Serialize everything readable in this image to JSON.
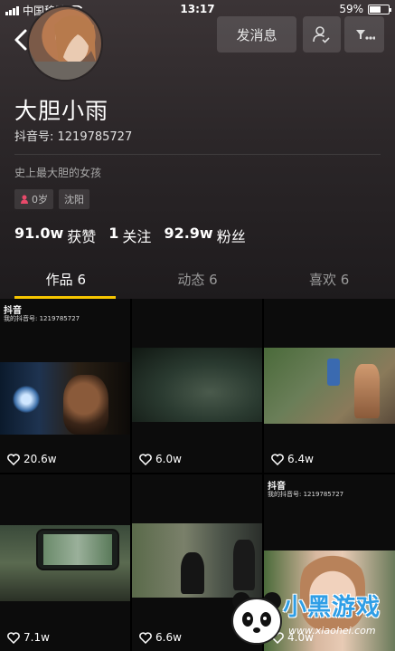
{
  "status_bar": {
    "carrier": "中国移动",
    "time": "13:17",
    "battery": "59%",
    "battery_level": 0.59
  },
  "header": {
    "message_button": "发消息",
    "follow_icon": "user-check-icon",
    "more_icon": "filter-more-icon"
  },
  "profile": {
    "nickname": "大胆小雨",
    "douyin_id": "抖音号: 1219785727",
    "bio": "史上最大胆的女孩",
    "tags": [
      {
        "icon": "gender-female-icon",
        "label": "0岁"
      },
      {
        "label": "沈阳"
      }
    ],
    "stats": [
      {
        "num": "91.0w",
        "label": "获赞"
      },
      {
        "num": "1",
        "label": "关注"
      },
      {
        "num": "92.9w",
        "label": "粉丝"
      }
    ]
  },
  "tabs": [
    {
      "label": "作品 6",
      "active": true
    },
    {
      "label": "动态 6",
      "active": false
    },
    {
      "label": "喜欢 6",
      "active": false
    }
  ],
  "videos": [
    {
      "likes": "20.6w",
      "watermark": "抖音",
      "watermark_id": "我的抖音号: 1219785727"
    },
    {
      "likes": "6.0w"
    },
    {
      "likes": "6.4w"
    },
    {
      "likes": "7.1w"
    },
    {
      "likes": "6.6w"
    },
    {
      "likes": "4.0w",
      "watermark": "抖音",
      "watermark_id": "我的抖音号: 1219785727"
    }
  ],
  "site_watermark": {
    "text": "小黑游戏",
    "url": "www.xiaohei.com"
  },
  "colors": {
    "accent": "#f7c600",
    "background": "#151515"
  }
}
